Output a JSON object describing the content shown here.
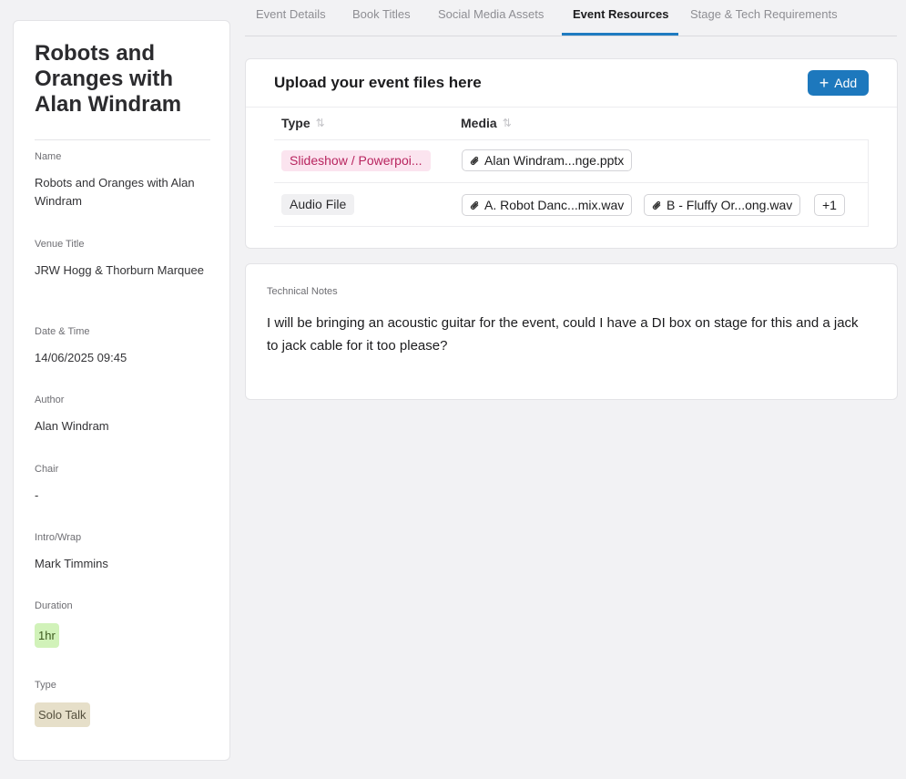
{
  "sidebar": {
    "title": "Robots and Oranges with Alan Windram",
    "fields": {
      "name": {
        "label": "Name",
        "value": "Robots and Oranges with Alan Windram"
      },
      "venue": {
        "label": "Venue Title",
        "value": "JRW Hogg & Thorburn Marquee"
      },
      "datetime": {
        "label": "Date & Time",
        "value": "14/06/2025 09:45"
      },
      "author": {
        "label": "Author",
        "value": "Alan Windram"
      },
      "chair": {
        "label": "Chair",
        "value": "-"
      },
      "intro": {
        "label": "Intro/Wrap",
        "value": "Mark Timmins"
      },
      "duration": {
        "label": "Duration",
        "value": "1hr"
      },
      "type": {
        "label": "Type",
        "value": "Solo Talk"
      }
    }
  },
  "tabs": [
    {
      "label": "Event Details"
    },
    {
      "label": "Book Titles"
    },
    {
      "label": "Social Media Assets"
    },
    {
      "label": "Event Resources"
    },
    {
      "label": "Stage & Tech Requirements"
    }
  ],
  "active_tab": "Event Resources",
  "upload": {
    "title": "Upload your event files here",
    "add_label": "Add",
    "columns": {
      "type": "Type",
      "media": "Media"
    },
    "rows": [
      {
        "type": "Slideshow / Powerpoi...",
        "media": [
          "Alan Windram...nge.pptx"
        ]
      },
      {
        "type": "Audio File",
        "media": [
          "A. Robot Danc...mix.wav",
          "B - Fluffy Or...ong.wav"
        ],
        "more": "+1"
      }
    ]
  },
  "notes": {
    "label": "Technical Notes",
    "text": "I will be bringing an acoustic guitar for the event, could I have a DI box on stage for this and a jack to jack cable for it too please?"
  },
  "colors": {
    "accent": "#1d78bd",
    "pink_tag": "#fbe4ef",
    "green_badge": "#d1f2b9",
    "tan_badge": "#e6dfc9"
  }
}
